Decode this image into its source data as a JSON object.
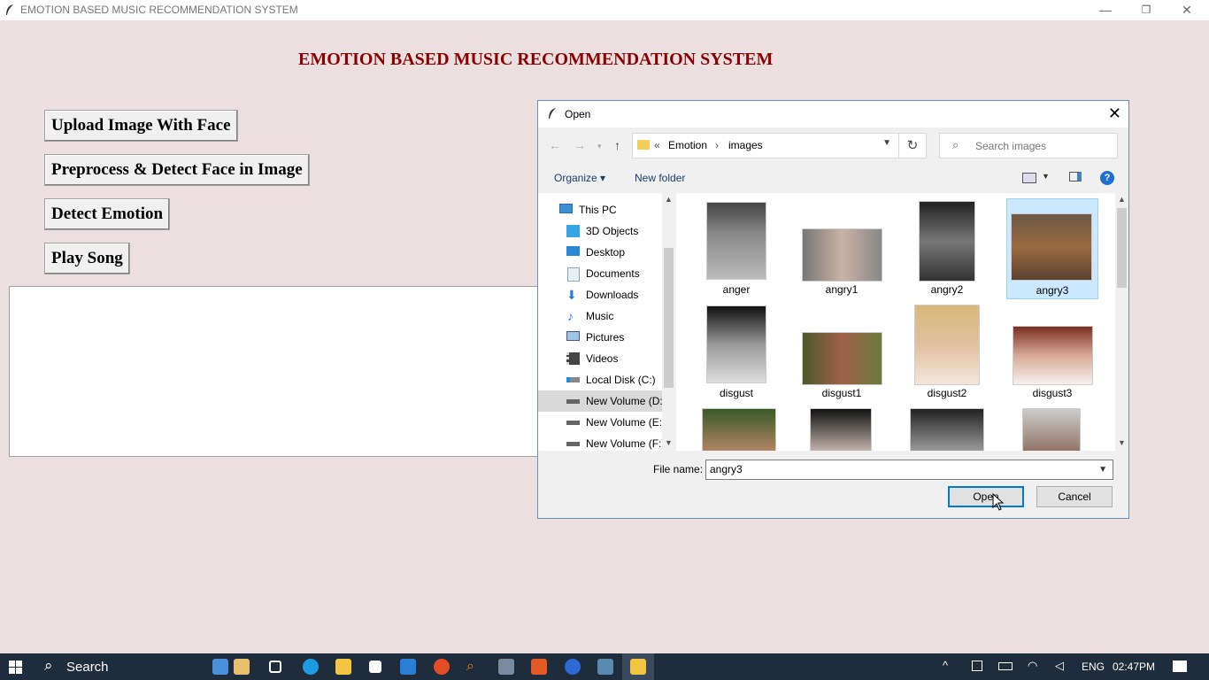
{
  "window": {
    "title": "EMOTION BASED MUSIC RECOMMENDATION SYSTEM",
    "minimize": "—",
    "maximize": "❐",
    "close": "✕"
  },
  "app": {
    "heading": "EMOTION BASED MUSIC RECOMMENDATION SYSTEM",
    "buttons": [
      {
        "label": "Upload Image With Face"
      },
      {
        "label": "Preprocess & Detect Face in Image"
      },
      {
        "label": "Detect Emotion"
      },
      {
        "label": "Play Song"
      }
    ]
  },
  "dialog": {
    "title": "Open",
    "close": "✕",
    "address": {
      "prefix": "«",
      "parts": [
        "Emotion",
        "images"
      ],
      "separator": "›"
    },
    "search_placeholder": "Search images",
    "organize": "Organize ▾",
    "new_folder": "New folder",
    "nav_items": [
      {
        "label": "This PC",
        "icon": "computer-icon"
      },
      {
        "label": "3D Objects",
        "icon": "cube-icon"
      },
      {
        "label": "Desktop",
        "icon": "desktop-icon"
      },
      {
        "label": "Documents",
        "icon": "document-icon"
      },
      {
        "label": "Downloads",
        "icon": "download-icon"
      },
      {
        "label": "Music",
        "icon": "music-icon"
      },
      {
        "label": "Pictures",
        "icon": "pictures-icon"
      },
      {
        "label": "Videos",
        "icon": "video-icon"
      },
      {
        "label": "Local Disk (C:)",
        "icon": "disk-icon"
      },
      {
        "label": "New Volume (D:",
        "icon": "drive-icon"
      },
      {
        "label": "New Volume (E:)",
        "icon": "drive-icon"
      },
      {
        "label": "New Volume (F:)",
        "icon": "drive-icon"
      }
    ],
    "files": [
      {
        "name": "anger"
      },
      {
        "name": "angry1"
      },
      {
        "name": "angry2"
      },
      {
        "name": "angry3"
      },
      {
        "name": "disgust"
      },
      {
        "name": "disgust1"
      },
      {
        "name": "disgust2"
      },
      {
        "name": "disgust3"
      },
      {
        "name": ""
      },
      {
        "name": ""
      },
      {
        "name": ""
      },
      {
        "name": ""
      }
    ],
    "file_name_label": "File name:",
    "file_name_value": "angry3",
    "open_label": "Open",
    "cancel_label": "Cancel"
  },
  "taskbar": {
    "search_label": "Search",
    "lang": "ENG",
    "time": "02:47PM"
  }
}
